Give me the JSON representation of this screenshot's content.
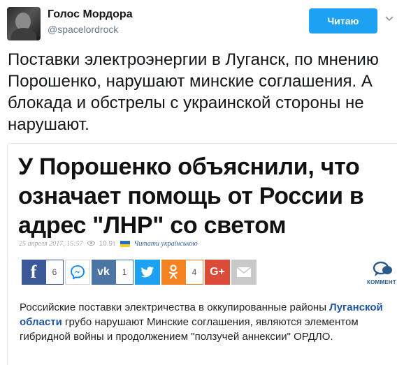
{
  "tweet": {
    "display_name": "Голос Мордора",
    "handle": "@spacelordrock",
    "follow_label": "Читаю",
    "text": "Поставки электроэнергии в Луганск, по мнению Порошенко, нарушают минские соглашения. А блокада и обстрелы с украинской стороны не нарушают."
  },
  "article": {
    "title": "У Порошенко объяснили, что означает помощь от России в адрес \"ЛНР\" со светом",
    "date": "25 апреля 2017, 15:57",
    "views": "10.9т",
    "read_ukrainian": "Читати українською",
    "share": {
      "facebook_count": "6",
      "vk_count": "1",
      "ok_count": "4",
      "comments_label": "КОММЕНТ"
    },
    "body_prefix": "Российские поставки электричества в оккупированные районы ",
    "body_link": "Луганской области",
    "body_suffix": " грубо нарушают Минские соглашения, являются элементом гибридной войны и продолжением \"ползучей аннексии\" ОРДЛО."
  },
  "colors": {
    "twitter_blue": "#1da1f2",
    "facebook": "#3b5998",
    "vk": "#4c75a3",
    "ok": "#f58220",
    "google_plus": "#dc4a38",
    "link": "#1f56a3"
  }
}
